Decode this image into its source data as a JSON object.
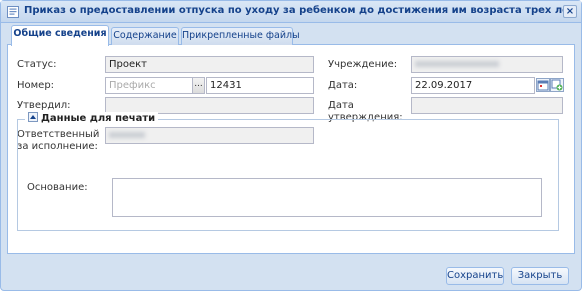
{
  "window": {
    "title": "Приказ о предоставлении отпуска по уходу за ребенком до достижения им возраста трех лет",
    "close_glyph": "×"
  },
  "tabs": [
    {
      "label": "Общие сведения",
      "active": true
    },
    {
      "label": "Содержание",
      "active": false
    },
    {
      "label": "Прикрепленные файлы",
      "active": false
    }
  ],
  "form": {
    "status_label": "Статус:",
    "status_value": "Проект",
    "number_label": "Номер:",
    "number_prefix_placeholder": "Префикс",
    "number_lookup_glyph": "...",
    "number_value": "12431",
    "approved_by_label": "Утвердил:",
    "approved_by_value": "",
    "responsible_label_line1": "Ответственный",
    "responsible_label_line2": "за исполнение:",
    "responsible_value": "",
    "institution_label": "Учреждение:",
    "institution_value": "",
    "date_label": "Дата:",
    "date_value": "22.09.2017",
    "approval_date_label_line1": "Дата",
    "approval_date_label_line2": "утверждения:",
    "approval_date_value": ""
  },
  "print_section": {
    "title": "Данные для печати",
    "basis_label": "Основание:",
    "basis_value": ""
  },
  "footer": {
    "save_label": "Сохранить",
    "close_label": "Закрыть"
  },
  "colors": {
    "accent": "#15428b",
    "border": "#99bbe8",
    "window_bg": "#d3e1f1"
  }
}
